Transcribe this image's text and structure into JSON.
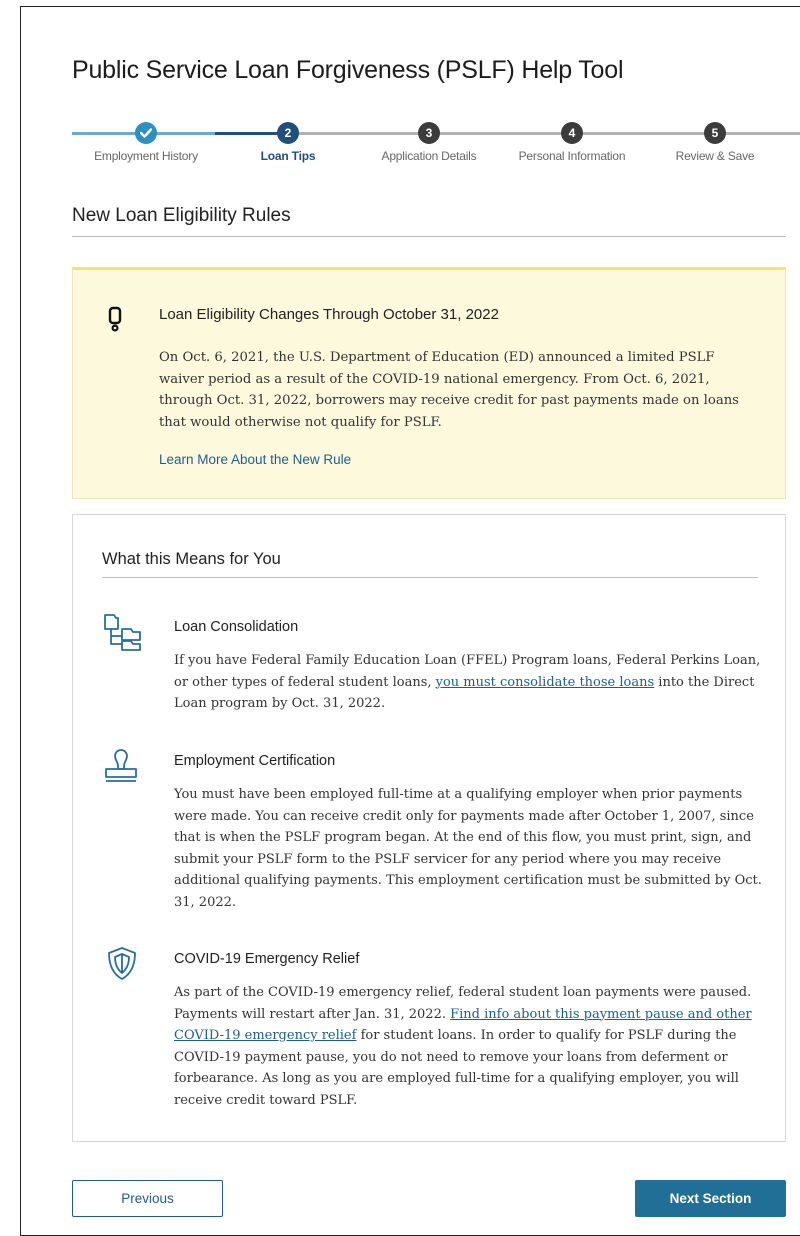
{
  "page": {
    "title": "Public Service Loan Forgiveness (PSLF) Help Tool"
  },
  "stepper": {
    "steps": [
      {
        "label": "Employment History",
        "number": "",
        "state": "complete"
      },
      {
        "label": "Loan Tips",
        "number": "2",
        "state": "active"
      },
      {
        "label": "Application Details",
        "number": "3",
        "state": "upcoming"
      },
      {
        "label": "Personal Information",
        "number": "4",
        "state": "upcoming"
      },
      {
        "label": "Review & Save",
        "number": "5",
        "state": "upcoming"
      }
    ],
    "colors": {
      "complete": "#2f8fbf",
      "active": "#1f4f7a",
      "upcoming": "#3c3c3c",
      "track_done": "#6aaccf",
      "track_todo": "#b3b3b3"
    }
  },
  "section": {
    "title": "New Loan Eligibility Rules"
  },
  "alert": {
    "icon": "exclamation-icon",
    "title": "Loan Eligibility Changes Through October 31, 2022",
    "body": "On Oct. 6, 2021, the U.S. Department of Education (ED) announced a limited PSLF waiver period as a result of the COVID-19 national emergency. From Oct. 6, 2021, through Oct. 31, 2022, borrowers may receive credit for past payments made on loans that would otherwise not qualify for PSLF.",
    "link": "Learn More About the New Rule",
    "background": "#fdf9dd"
  },
  "card": {
    "title": "What this Means for You",
    "items": [
      {
        "icon": "folder-tree-icon",
        "title": "Loan Consolidation",
        "body_before": "If you have Federal Family Education Loan (FFEL) Program loans, Federal Perkins Loan, or other types of federal student loans, ",
        "link": "you must consolidate those loans",
        "body_after": " into the Direct Loan program by Oct. 31, 2022."
      },
      {
        "icon": "stamp-icon",
        "title": "Employment Certification",
        "body": "You must have been employed full-time at a qualifying employer when prior payments were made. You can receive credit only for payments made after October 1, 2007, since that is when the PSLF program began. At the end of this flow, you must print, sign, and submit your PSLF form to the PSLF servicer for any period where you may receive additional qualifying payments. This employment certification must be submitted by Oct. 31, 2022."
      },
      {
        "icon": "shield-icon",
        "title": "COVID-19 Emergency Relief",
        "body_before": "As part of the COVID-19 emergency relief, federal student loan payments were paused. Payments will restart after Jan. 31, 2022. ",
        "link": "Find info about this payment pause and other COVID-19 emergency relief",
        "body_after": " for student loans. In order to qualify for PSLF during the COVID-19 payment pause, you do not need to remove your loans from deferment or forbearance. As long as you are employed full-time for a qualifying employer, you will receive credit toward PSLF."
      }
    ]
  },
  "nav": {
    "previous": "Previous",
    "next": "Next Section"
  },
  "colors": {
    "primary": "#216e96",
    "link": "#215d8c"
  }
}
